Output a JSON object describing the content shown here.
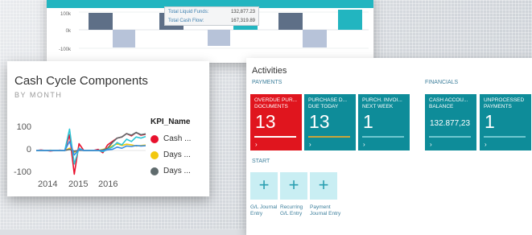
{
  "top_chart": {
    "y_ticks": [
      "100k",
      "0k",
      "-100k"
    ],
    "tooltip": {
      "rows": [
        {
          "label": "Total Liquid Funds:",
          "value": "132,877.23"
        },
        {
          "label": "Total Cash Flow:",
          "value": "167,319.89"
        }
      ]
    },
    "colors": {
      "dark_bar": "#5e6f87",
      "light_bar": "#b7c3d9",
      "teal": "#22b5c0"
    }
  },
  "cycle_card": {
    "title": "Cash Cycle Components",
    "subtitle": "BY MONTH",
    "legend_title": "KPI_Name",
    "legend": [
      {
        "label": "Cash ...",
        "color": "#e8112d"
      },
      {
        "label": "Days ...",
        "color": "#f2c80f"
      },
      {
        "label": "Days ...",
        "color": "#5f6b6d"
      }
    ],
    "chart_data": {
      "type": "line",
      "x": [
        "2014",
        "2015",
        "2016"
      ],
      "ylim": [
        -100,
        100
      ],
      "y_ticks": [
        "100",
        "0",
        "-100"
      ],
      "series": [
        {
          "name": "Cash ...",
          "color": "#e8112d",
          "values": [
            0,
            2,
            0,
            -2,
            0,
            1,
            0,
            70,
            -105,
            30,
            0,
            0,
            0,
            5,
            -10,
            25,
            40,
            55,
            60,
            75,
            65,
            80,
            68,
            72
          ]
        },
        {
          "name": "Days ...",
          "color": "#f2c80f",
          "values": [
            0,
            0,
            0,
            1,
            0,
            0,
            0,
            10,
            -8,
            2,
            0,
            0,
            0,
            0,
            5,
            10,
            20,
            30,
            22,
            28,
            25,
            20,
            22,
            24
          ]
        },
        {
          "name": "Days ...",
          "color": "#5f6b6d",
          "values": [
            0,
            0,
            0,
            0,
            0,
            0,
            0,
            5,
            -3,
            1,
            0,
            0,
            0,
            0,
            2,
            10,
            35,
            55,
            60,
            75,
            68,
            80,
            70,
            74
          ]
        },
        {
          "color": "#2bc6d6",
          "values": [
            0,
            0,
            0,
            0,
            0,
            0,
            0,
            95,
            -60,
            10,
            0,
            0,
            0,
            0,
            -5,
            5,
            15,
            35,
            25,
            50,
            40,
            60,
            55,
            62
          ]
        },
        {
          "color": "#3a8de0",
          "values": [
            0,
            0,
            0,
            0,
            0,
            0,
            0,
            40,
            -20,
            5,
            0,
            0,
            0,
            0,
            0,
            3,
            5,
            15,
            10,
            20,
            18,
            22,
            20,
            21
          ]
        }
      ]
    }
  },
  "activities": {
    "title": "Activities",
    "sections": {
      "payments": "PAYMENTS",
      "financials": "FINANCIALS",
      "start": "START"
    },
    "tiles": [
      {
        "label": "OVERDUE PUR... DOCUMENTS",
        "value": "13",
        "color": "#e0151e",
        "bar_color": "#ffffff"
      },
      {
        "label": "PURCHASE D... DUE TODAY",
        "value": "13",
        "color": "#0e8c99",
        "bar_color": "#c9a53a"
      },
      {
        "label": "PURCH. INVOI... NEXT WEEK",
        "value": "1",
        "color": "#0e8c99",
        "bar_color": "#6ec7cf"
      },
      {
        "label": "CASH ACCOU... BALANCE",
        "value": "132.877,23",
        "color": "#0e8c99",
        "bar_color": "#6ec7cf"
      },
      {
        "label": "UNPROCESSED PAYMENTS",
        "value": "1",
        "color": "#0e8c99",
        "bar_color": "#6ec7cf"
      }
    ],
    "chevron": "›",
    "start_actions": [
      {
        "icon": "plus-icon",
        "glyph": "+",
        "label": "G/L Journal Entry"
      },
      {
        "icon": "plus-icon",
        "glyph": "+",
        "label": "Recurring G/L Entry"
      },
      {
        "icon": "plus-icon",
        "glyph": "+",
        "label": "Payment Journal Entry"
      }
    ]
  }
}
